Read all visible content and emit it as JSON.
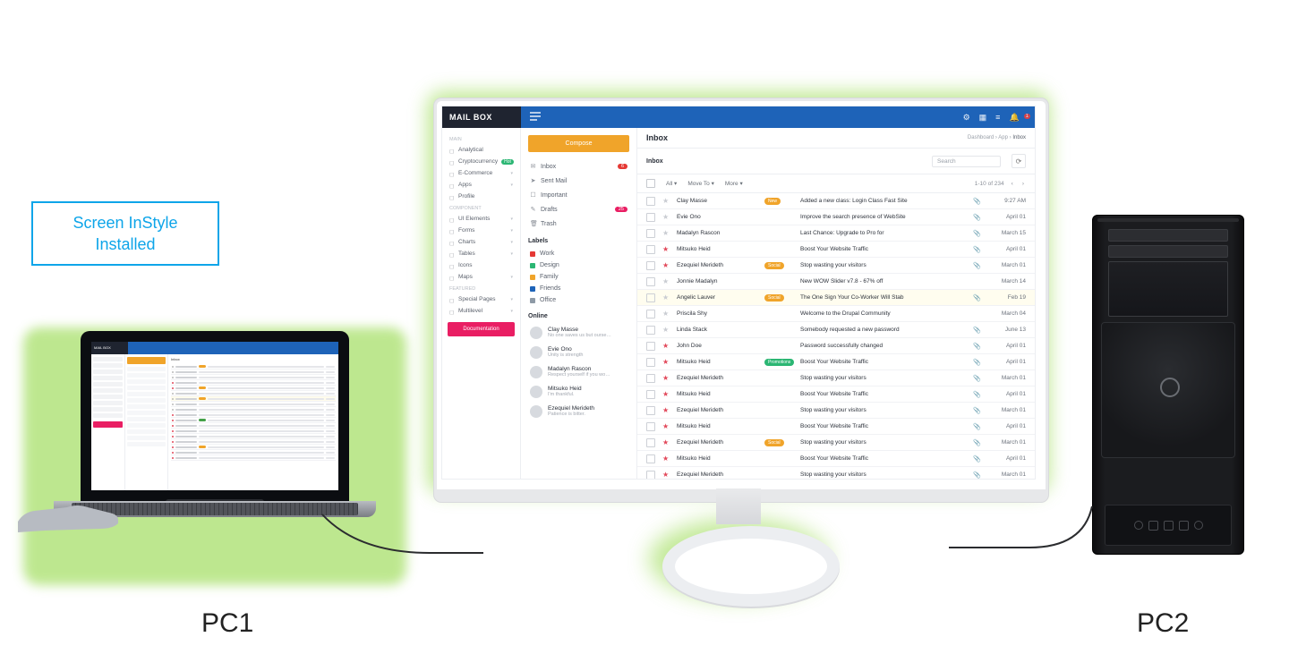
{
  "callout": {
    "line1": "Screen InStyle",
    "line2": "Installed"
  },
  "labels": {
    "pc1": "PC1",
    "pc2": "PC2"
  },
  "app": {
    "brand": "MAIL BOX",
    "headerIcons": {
      "gear": "gear-icon",
      "grid": "app-grid-icon",
      "list": "list-icon",
      "bell": "bell-icon",
      "bellCount": "1"
    },
    "pageTitle": "Inbox",
    "breadcrumb": {
      "a": "Dashboard",
      "b": "App",
      "c": "Inbox"
    },
    "nav": {
      "sect1": "MAIN",
      "items1": [
        {
          "label": "Analytical"
        },
        {
          "label": "Cryptocurrency",
          "hot": "Hot"
        },
        {
          "label": "E-Commerce",
          "chev": true
        },
        {
          "label": "Apps",
          "chev": true
        },
        {
          "label": "Profile"
        }
      ],
      "sect2": "COMPONENT",
      "items2": [
        {
          "label": "UI Elements",
          "chev": true
        },
        {
          "label": "Forms",
          "chev": true
        },
        {
          "label": "Charts",
          "chev": true
        },
        {
          "label": "Tables",
          "chev": true
        },
        {
          "label": "Icons"
        },
        {
          "label": "Maps",
          "chev": true
        }
      ],
      "sect3": "FEATURED",
      "items3": [
        {
          "label": "Special Pages",
          "chev": true
        },
        {
          "label": "Multilevel",
          "chev": true
        }
      ],
      "doc": "Documentation"
    },
    "mail": {
      "compose": "Compose",
      "folders": [
        {
          "icon": "✉",
          "label": "Inbox",
          "count": "6"
        },
        {
          "icon": "➤",
          "label": "Sent Mail"
        },
        {
          "icon": "☐",
          "label": "Important"
        },
        {
          "icon": "✎",
          "label": "Drafts",
          "count": "25",
          "grey": true
        },
        {
          "icon": "🗑",
          "label": "Trash"
        }
      ],
      "labelsHeader": "Labels",
      "labels": [
        {
          "color": "#e53935",
          "label": "Work"
        },
        {
          "color": "#2bb673",
          "label": "Design"
        },
        {
          "color": "#f0a42a",
          "label": "Family"
        },
        {
          "color": "#1e63b8",
          "label": "Friends"
        },
        {
          "color": "#8e9aa6",
          "label": "Office"
        }
      ],
      "onlineHeader": "Online",
      "online": [
        {
          "name": "Clay Masse",
          "status": "No one saves us but ourse…"
        },
        {
          "name": "Evie Ono",
          "status": "Unity is strength"
        },
        {
          "name": "Madalyn Rascon",
          "status": "Respect yourself if you wo…"
        },
        {
          "name": "Mitsuko Heid",
          "status": "I'm thankful."
        },
        {
          "name": "Ezequiel Merideth",
          "status": "Patience is bitter."
        }
      ]
    },
    "list": {
      "title": "Inbox",
      "search": "Search",
      "toolbar": {
        "all": "All",
        "moveTo": "Move To",
        "more": "More",
        "range": "1-10 of 234"
      },
      "rows": [
        {
          "star": false,
          "from": "Clay Masse",
          "tag": "New",
          "tagColor": "#f0a42a",
          "subject": "Added a new class: Login Class Fast Site",
          "attach": true,
          "date": "9:27 AM"
        },
        {
          "star": false,
          "from": "Evie Ono",
          "subject": "Improve the search presence of WebSite",
          "attach": true,
          "date": "April 01"
        },
        {
          "star": false,
          "from": "Madalyn Rascon",
          "subject": "Last Chance: Upgrade to Pro for",
          "attach": true,
          "date": "March 15"
        },
        {
          "star": true,
          "from": "Mitsuko Heid",
          "subject": "Boost Your Website Traffic",
          "attach": true,
          "date": "April 01"
        },
        {
          "star": true,
          "from": "Ezequiel Merideth",
          "tag": "Social",
          "tagColor": "#f0a42a",
          "subject": "Stop wasting your visitors",
          "attach": true,
          "date": "March 01"
        },
        {
          "star": false,
          "from": "Jonnie Madalyn",
          "subject": "New WOW Slider v7.8 - 67% off",
          "date": "March 14"
        },
        {
          "selected": true,
          "star": false,
          "from": "Angelic Lauver",
          "tag": "Social",
          "tagColor": "#f0a42a",
          "subject": "The One Sign Your Co-Worker Will Stab",
          "attach": true,
          "date": "Feb 19"
        },
        {
          "star": false,
          "from": "Priscila Shy",
          "subject": "Welcome to the Drupal Community",
          "date": "March 04"
        },
        {
          "star": false,
          "from": "Linda Stack",
          "subject": "Somebody requested a new password",
          "attach": true,
          "date": "June 13"
        },
        {
          "star": true,
          "from": "John Doe",
          "subject": "Password successfully changed",
          "attach": true,
          "date": "April 01"
        },
        {
          "star": true,
          "from": "Mitsuko Heid",
          "tag": "Promotions",
          "tagColor": "#2bb673",
          "subject": "Boost Your Website Traffic",
          "attach": true,
          "date": "April 01"
        },
        {
          "star": true,
          "from": "Ezequiel Merideth",
          "subject": "Stop wasting your visitors",
          "attach": true,
          "date": "March 01"
        },
        {
          "star": true,
          "from": "Mitsuko Heid",
          "subject": "Boost Your Website Traffic",
          "attach": true,
          "date": "April 01"
        },
        {
          "star": true,
          "from": "Ezequiel Merideth",
          "subject": "Stop wasting your visitors",
          "attach": true,
          "date": "March 01"
        },
        {
          "star": true,
          "from": "Mitsuko Heid",
          "subject": "Boost Your Website Traffic",
          "attach": true,
          "date": "April 01"
        },
        {
          "star": true,
          "from": "Ezequiel Merideth",
          "tag": "Social",
          "tagColor": "#f0a42a",
          "subject": "Stop wasting your visitors",
          "attach": true,
          "date": "March 01"
        },
        {
          "star": true,
          "from": "Mitsuko Heid",
          "subject": "Boost Your Website Traffic",
          "attach": true,
          "date": "April 01"
        },
        {
          "star": true,
          "from": "Ezequiel Merideth",
          "subject": "Stop wasting your visitors",
          "attach": true,
          "date": "March 01"
        }
      ]
    }
  }
}
